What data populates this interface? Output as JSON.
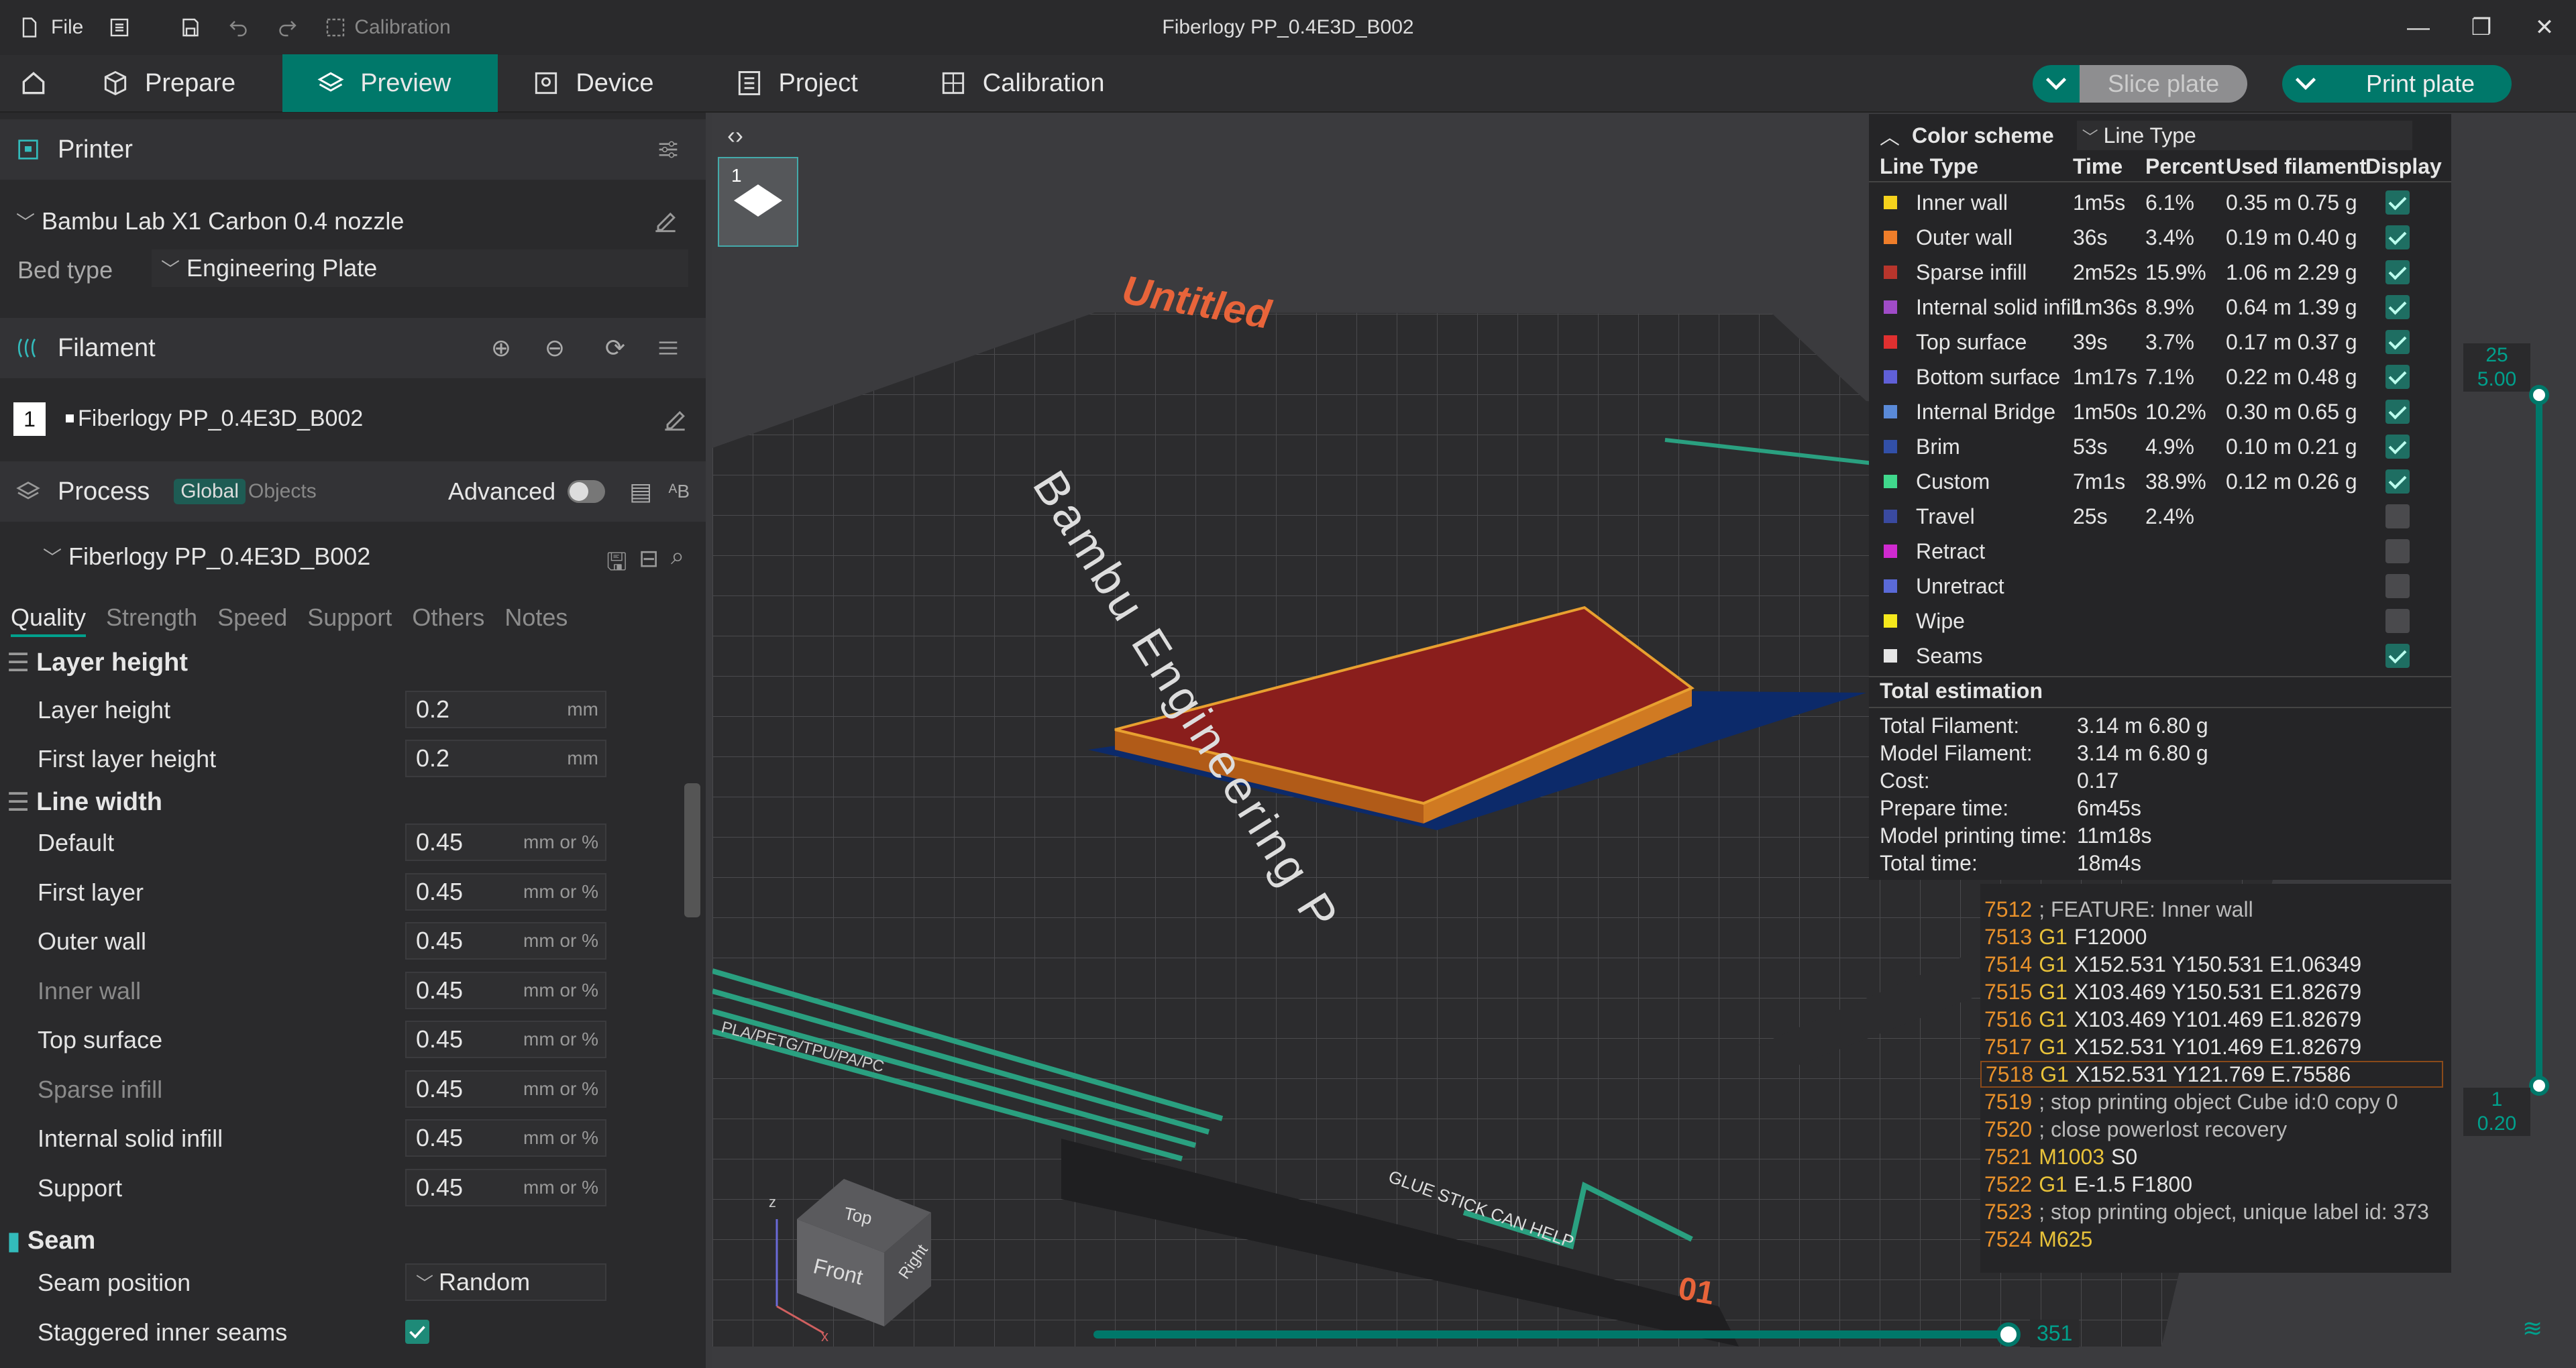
{
  "titlebar": {
    "file": "File",
    "calibration": "Calibration",
    "title": "Fiberlogy PP_0.4E3D_B002"
  },
  "nav": {
    "tabs": [
      {
        "label": "Prepare"
      },
      {
        "label": "Preview"
      },
      {
        "label": "Device"
      },
      {
        "label": "Project"
      },
      {
        "label": "Calibration"
      }
    ],
    "active": "Preview"
  },
  "actions": {
    "slice": "Slice plate",
    "print": "Print plate"
  },
  "printer": {
    "section": "Printer",
    "name": "Bambu Lab X1 Carbon 0.4 nozzle",
    "bed_type_label": "Bed type",
    "bed_type": "Engineering Plate"
  },
  "filament": {
    "section": "Filament",
    "index": "1",
    "name": "Fiberlogy PP_0.4E3D_B002"
  },
  "process": {
    "section": "Process",
    "global": "Global",
    "objects": "Objects",
    "advanced": "Advanced",
    "preset": "Fiberlogy PP_0.4E3D_B002",
    "tabs": [
      "Quality",
      "Strength",
      "Speed",
      "Support",
      "Others",
      "Notes"
    ]
  },
  "params": {
    "layer_height_group": "Layer height",
    "layer_height": {
      "label": "Layer height",
      "value": "0.2",
      "unit": "mm"
    },
    "first_layer_height": {
      "label": "First layer height",
      "value": "0.2",
      "unit": "mm"
    },
    "line_width_group": "Line width",
    "lw": [
      {
        "label": "Default",
        "value": "0.45",
        "unit": "mm or %"
      },
      {
        "label": "First layer",
        "value": "0.45",
        "unit": "mm or %"
      },
      {
        "label": "Outer wall",
        "value": "0.45",
        "unit": "mm or %"
      },
      {
        "label": "Inner wall",
        "value": "0.45",
        "unit": "mm or %"
      },
      {
        "label": "Top surface",
        "value": "0.45",
        "unit": "mm or %"
      },
      {
        "label": "Sparse infill",
        "value": "0.45",
        "unit": "mm or %"
      },
      {
        "label": "Internal solid infill",
        "value": "0.45",
        "unit": "mm or %"
      },
      {
        "label": "Support",
        "value": "0.45",
        "unit": "mm or %"
      }
    ],
    "seam_group": "Seam",
    "seam_position": {
      "label": "Seam position",
      "value": "Random"
    },
    "staggered": {
      "label": "Staggered inner seams"
    }
  },
  "plate": {
    "name": "Untitled",
    "brand": "Bambu Engineering P",
    "number": "01",
    "glue": "GLUE STICK CAN HELP",
    "materials": "PLA/PETG/TPU/PA/PC",
    "thumb": "1"
  },
  "legend": {
    "color_scheme": "Color scheme",
    "scheme": "Line Type",
    "headers": [
      "Line Type",
      "Time",
      "Percent",
      "Used filament",
      "Display"
    ],
    "rows": [
      {
        "name": "Inner wall",
        "time": "1m5s",
        "pct": "6.1%",
        "used": "0.35 m  0.75 g",
        "color": "#f5d21c",
        "on": true
      },
      {
        "name": "Outer wall",
        "time": "36s",
        "pct": "3.4%",
        "used": "0.19 m  0.40 g",
        "color": "#f07e2a",
        "on": true
      },
      {
        "name": "Sparse infill",
        "time": "2m52s",
        "pct": "15.9%",
        "used": "1.06 m  2.29 g",
        "color": "#b8352c",
        "on": true
      },
      {
        "name": "Internal solid infill",
        "time": "1m36s",
        "pct": "8.9%",
        "used": "0.64 m  1.39 g",
        "color": "#a04cc8",
        "on": true
      },
      {
        "name": "Top surface",
        "time": "39s",
        "pct": "3.7%",
        "used": "0.17 m  0.37 g",
        "color": "#e03030",
        "on": true
      },
      {
        "name": "Bottom surface",
        "time": "1m17s",
        "pct": "7.1%",
        "used": "0.22 m  0.48 g",
        "color": "#6060d8",
        "on": true
      },
      {
        "name": "Internal Bridge",
        "time": "1m50s",
        "pct": "10.2%",
        "used": "0.30 m  0.65 g",
        "color": "#5a8ad8",
        "on": true
      },
      {
        "name": "Brim",
        "time": "53s",
        "pct": "4.9%",
        "used": "0.10 m  0.21 g",
        "color": "#3250a8",
        "on": true
      },
      {
        "name": "Custom",
        "time": "7m1s",
        "pct": "38.9%",
        "used": "0.12 m  0.26 g",
        "color": "#40d88c",
        "on": true
      },
      {
        "name": "Travel",
        "time": "25s",
        "pct": "2.4%",
        "used": "",
        "color": "#3a4aa0",
        "on": false
      },
      {
        "name": "Retract",
        "time": "",
        "pct": "",
        "used": "",
        "color": "#d02ad0",
        "on": false
      },
      {
        "name": "Unretract",
        "time": "",
        "pct": "",
        "used": "",
        "color": "#5a6ad8",
        "on": false
      },
      {
        "name": "Wipe",
        "time": "",
        "pct": "",
        "used": "",
        "color": "#f5e81c",
        "on": false
      },
      {
        "name": "Seams",
        "time": "",
        "pct": "",
        "used": "",
        "color": "#e6e6e6",
        "on": true
      }
    ],
    "total_title": "Total estimation",
    "totals": [
      {
        "k": "Total Filament:",
        "v": "3.14 m   6.80 g"
      },
      {
        "k": "Model Filament:",
        "v": "3.14 m   6.80 g"
      },
      {
        "k": "Cost:",
        "v": "0.17"
      },
      {
        "k": "Prepare time:",
        "v": "6m45s"
      },
      {
        "k": "Model printing time:",
        "v": "11m18s"
      },
      {
        "k": "Total time:",
        "v": "18m4s"
      }
    ]
  },
  "gcode": [
    {
      "n": "7512",
      "c": "",
      "t": "; FEATURE: Inner wall"
    },
    {
      "n": "7513",
      "c": "G1",
      "t": "F12000"
    },
    {
      "n": "7514",
      "c": "G1",
      "t": "X152.531 Y150.531 E1.06349"
    },
    {
      "n": "7515",
      "c": "G1",
      "t": "X103.469 Y150.531 E1.82679"
    },
    {
      "n": "7516",
      "c": "G1",
      "t": "X103.469 Y101.469 E1.82679"
    },
    {
      "n": "7517",
      "c": "G1",
      "t": "X152.531 Y101.469 E1.82679"
    },
    {
      "n": "7518",
      "c": "G1",
      "t": "X152.531 Y121.769 E.75586"
    },
    {
      "n": "7519",
      "c": "",
      "t": "; stop printing object Cube id:0 copy 0"
    },
    {
      "n": "7520",
      "c": "",
      "t": "; close powerlost recovery"
    },
    {
      "n": "7521",
      "c": "M1003",
      "t": "S0"
    },
    {
      "n": "7522",
      "c": "G1",
      "t": "E-1.5 F1800"
    },
    {
      "n": "7523",
      "c": "",
      "t": "; stop printing object, unique label id: 373"
    },
    {
      "n": "7524",
      "c": "M625",
      "t": ""
    }
  ],
  "layers": {
    "top": "25",
    "top_h": "5.00",
    "bottom": "1",
    "bottom_h": "0.20",
    "moves": "351"
  },
  "cube": {
    "top": "Top",
    "front": "Front",
    "right": "Right",
    "z": "z",
    "x": "x"
  }
}
